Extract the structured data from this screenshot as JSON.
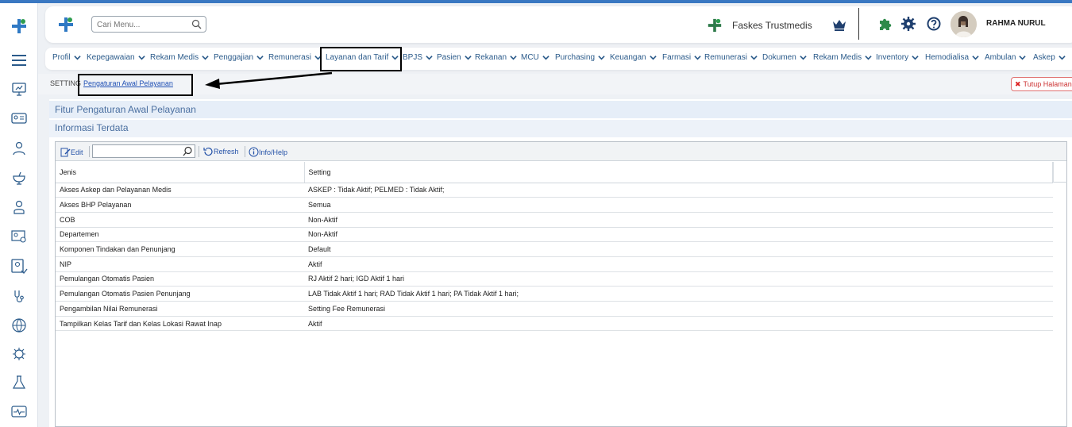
{
  "header": {
    "search_placeholder": "Cari Menu...",
    "facility_name": "Faskes Trustmedis",
    "user_name": "RAHMA NURUL"
  },
  "menu": [
    {
      "label": "Profil"
    },
    {
      "label": "Kepegawaian"
    },
    {
      "label": "Rekam Medis"
    },
    {
      "label": "Penggajian"
    },
    {
      "label": "Remunerasi"
    },
    {
      "label": "Layanan dan Tarif"
    },
    {
      "label": "BPJS"
    },
    {
      "label": "Pasien"
    },
    {
      "label": "Rekanan"
    },
    {
      "label": "MCU"
    },
    {
      "label": "Purchasing"
    },
    {
      "label": "Keuangan"
    },
    {
      "label": "Farmasi"
    },
    {
      "label": "Remunerasi"
    },
    {
      "label": "Dokumen"
    },
    {
      "label": "Rekam Medis"
    },
    {
      "label": "Inventory"
    },
    {
      "label": "Hemodialisa"
    },
    {
      "label": "Ambulan"
    },
    {
      "label": "Askep"
    }
  ],
  "breadcrumb": {
    "section": "SETTING",
    "page": "Pengaturan Awal Pelayanan"
  },
  "close_button": "Tutup Halaman",
  "panel": {
    "title": "Fitur Pengaturan Awal Pelayanan",
    "subtitle": "Informasi Terdata"
  },
  "toolbar": {
    "edit": "Edit",
    "refresh": "Refresh",
    "help": "Info/Help"
  },
  "table": {
    "columns": [
      "Jenis",
      "Setting"
    ],
    "rows": [
      [
        "Akses Askep dan Pelayanan Medis",
        "ASKEP : Tidak Aktif; PELMED : Tidak Aktif;"
      ],
      [
        "Akses BHP Pelayanan",
        "Semua"
      ],
      [
        "COB",
        "Non-Aktif"
      ],
      [
        "Departemen",
        "Non-Aktif"
      ],
      [
        "Komponen Tindakan dan Penunjang",
        "Default"
      ],
      [
        "NIP",
        "Aktif"
      ],
      [
        "Pemulangan Otomatis Pasien",
        "RJ Aktif 2 hari; IGD Aktif 1 hari"
      ],
      [
        "Pemulangan Otomatis Pasien Penunjang",
        "LAB Tidak Aktif 1 hari; RAD Tidak Aktif 1 hari; PA Tidak Aktif 1 hari;"
      ],
      [
        "Pengambilan Nilai Remunerasi",
        "Setting Fee Remunerasi"
      ],
      [
        "Tampilkan Kelas Tarif dan Kelas Lokasi Rawat Inap",
        "Aktif"
      ]
    ]
  },
  "colors": {
    "brand_green": "#2e9d4f",
    "brand_blue": "#1f4fb4",
    "link": "#2a5a8a"
  }
}
